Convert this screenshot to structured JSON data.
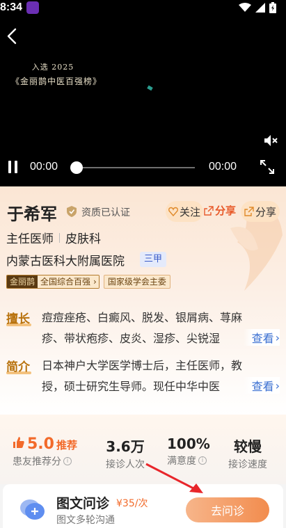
{
  "status_bar": {
    "time": "8:34"
  },
  "video": {
    "overlay_line1": "入选 2025",
    "overlay_line2": "《金丽鹊中医百强榜》",
    "current_time": "00:00",
    "total_time": "00:00",
    "progress": 0
  },
  "doctor": {
    "name": "于希军",
    "verified_label": "资质已认证",
    "follow_label": "关注",
    "share_label_1": "分享",
    "share_label_2": "分享",
    "title": "主任医师",
    "department": "皮肤科",
    "hospital": "内蒙古医科大附属医院",
    "hospital_grade": "三甲",
    "honor_brand": "金丽鹊",
    "honor_rank": "全国综合百强",
    "honor_tag": "国家级学会主委"
  },
  "expertise": {
    "label": "擅长",
    "text": "痘痘痤疮、白癜风、脱发、银屑病、荨麻疹、带状疱疹、皮炎、湿疹、尖锐湿",
    "more": "查看"
  },
  "intro": {
    "label": "简介",
    "text": "日本神户大学医学博士后，主任医师，教授，硕士研究生导师。现任中华中医",
    "more": "查看"
  },
  "stats": {
    "recommend_score": "5.0",
    "recommend_word": "推荐",
    "recommend_label": "患友推荐分",
    "consultations": "3.6万",
    "consultations_label": "接诊人次",
    "satisfaction": "100%",
    "satisfaction_label": "满意度",
    "speed": "较慢",
    "speed_label": "接诊速度"
  },
  "consult": {
    "title": "图文问诊",
    "price": "¥35/次",
    "subtitle": "图文多轮沟通",
    "button": "去问诊"
  },
  "colors": {
    "accent": "#f26a2a",
    "link": "#3a6fd1",
    "gold": "#b8720d"
  }
}
